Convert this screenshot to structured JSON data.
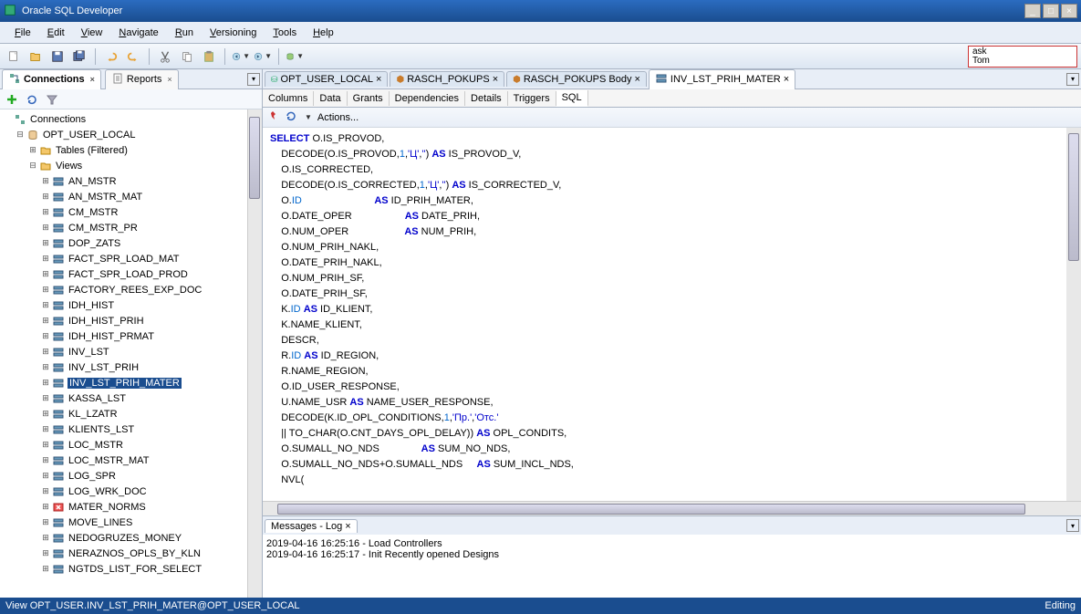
{
  "title": "Oracle SQL Developer",
  "menu": [
    "File",
    "Edit",
    "View",
    "Navigate",
    "Run",
    "Versioning",
    "Tools",
    "Help"
  ],
  "search": {
    "line1": "ask",
    "line2": "Tom"
  },
  "leftTabs": {
    "connections": "Connections",
    "reports": "Reports"
  },
  "tree": {
    "root": "Connections",
    "conn": "OPT_USER_LOCAL",
    "tables": "Tables (Filtered)",
    "views": "Views",
    "items": [
      "AN_MSTR",
      "AN_MSTR_MAT",
      "CM_MSTR",
      "CM_MSTR_PR",
      "DOP_ZATS",
      "FACT_SPR_LOAD_MAT",
      "FACT_SPR_LOAD_PROD",
      "FACTORY_REES_EXP_DOC",
      "IDH_HIST",
      "IDH_HIST_PRIH",
      "IDH_HIST_PRMAT",
      "INV_LST",
      "INV_LST_PRIH",
      "INV_LST_PRIH_MATER",
      "KASSA_LST",
      "KL_LZATR",
      "KLIENTS_LST",
      "LOC_MSTR",
      "LOC_MSTR_MAT",
      "LOG_SPR",
      "LOG_WRK_DOC",
      "MATER_NORMS",
      "MOVE_LINES",
      "NEDOGRUZES_MONEY",
      "NERAZNOS_OPLS_BY_KLN",
      "NGTDS_LIST_FOR_SELECT"
    ],
    "selected": "INV_LST_PRIH_MATER"
  },
  "editorTabs": [
    {
      "label": "OPT_USER_LOCAL",
      "type": "sql"
    },
    {
      "label": "RASCH_POKUPS",
      "type": "cube"
    },
    {
      "label": "RASCH_POKUPS Body",
      "type": "cube"
    },
    {
      "label": "INV_LST_PRIH_MATER",
      "type": "view",
      "active": true
    }
  ],
  "subTabs": [
    "Columns",
    "Data",
    "Grants",
    "Dependencies",
    "Details",
    "Triggers",
    "SQL"
  ],
  "subTabActive": "SQL",
  "actionsLabel": "Actions...",
  "code": [
    {
      "t": "SELECT O.IS_PROVOD,",
      "tokens": [
        {
          "s": "SELECT",
          "c": "kw"
        }
      ]
    },
    {
      "t": "    DECODE(O.IS_PROVOD,1,'Ц','') AS IS_PROVOD_V,",
      "tokens": [
        {
          "s": "1",
          "c": "id"
        },
        {
          "s": "'Ц'",
          "c": "str"
        },
        {
          "s": "''",
          "c": "str"
        },
        {
          "s": "AS",
          "c": "kw"
        }
      ]
    },
    {
      "t": "    O.IS_CORRECTED,"
    },
    {
      "t": "    DECODE(O.IS_CORRECTED,1,'Ц','') AS IS_CORRECTED_V,",
      "tokens": [
        {
          "s": "1",
          "c": "id"
        },
        {
          "s": "'Ц'",
          "c": "str"
        },
        {
          "s": "''",
          "c": "str"
        },
        {
          "s": "AS",
          "c": "kw"
        }
      ]
    },
    {
      "t": "    O.ID                          AS ID_PRIH_MATER,",
      "tokens": [
        {
          "s": "ID",
          "c": "id"
        },
        {
          "s": "AS",
          "c": "kw"
        }
      ]
    },
    {
      "t": "    O.DATE_OPER                   AS DATE_PRIH,",
      "tokens": [
        {
          "s": "AS",
          "c": "kw"
        }
      ]
    },
    {
      "t": "    O.NUM_OPER                    AS NUM_PRIH,",
      "tokens": [
        {
          "s": "AS",
          "c": "kw"
        }
      ]
    },
    {
      "t": "    O.NUM_PRIH_NAKL,"
    },
    {
      "t": "    O.DATE_PRIH_NAKL,"
    },
    {
      "t": "    O.NUM_PRIH_SF,"
    },
    {
      "t": "    O.DATE_PRIH_SF,"
    },
    {
      "t": "    K.ID AS ID_KLIENT,",
      "tokens": [
        {
          "s": "ID",
          "c": "id"
        },
        {
          "s": "AS",
          "c": "kw"
        }
      ]
    },
    {
      "t": "    K.NAME_KLIENT,"
    },
    {
      "t": "    DESCR,"
    },
    {
      "t": "    R.ID AS ID_REGION,",
      "tokens": [
        {
          "s": "ID",
          "c": "id"
        },
        {
          "s": "AS",
          "c": "kw"
        }
      ]
    },
    {
      "t": "    R.NAME_REGION,"
    },
    {
      "t": "    O.ID_USER_RESPONSE,"
    },
    {
      "t": "    U.NAME_USR AS NAME_USER_RESPONSE,",
      "tokens": [
        {
          "s": "AS",
          "c": "kw"
        }
      ]
    },
    {
      "t": "    DECODE(K.ID_OPL_CONDITIONS,1,'Пр.','Отс.'",
      "tokens": [
        {
          "s": "1",
          "c": "id"
        },
        {
          "s": "'Пр.'",
          "c": "str"
        },
        {
          "s": "'Отс.'",
          "c": "str"
        }
      ]
    },
    {
      "t": "    || TO_CHAR(O.CNT_DAYS_OPL_DELAY)) AS OPL_CONDITS,",
      "tokens": [
        {
          "s": "AS",
          "c": "kw"
        }
      ]
    },
    {
      "t": "    O.SUMALL_NO_NDS               AS SUM_NO_NDS,",
      "tokens": [
        {
          "s": "AS",
          "c": "kw"
        }
      ]
    },
    {
      "t": "    O.SUMALL_NO_NDS+O.SUMALL_NDS     AS SUM_INCL_NDS,",
      "tokens": [
        {
          "s": "AS",
          "c": "kw"
        }
      ]
    },
    {
      "t": "    NVL("
    }
  ],
  "log": {
    "title": "Messages - Log",
    "lines": [
      "2019-04-16 16:25:16 - Load Controllers",
      "2019-04-16 16:25:17 - Init Recently opened Designs"
    ]
  },
  "status": {
    "left": "View OPT_USER.INV_LST_PRIH_MATER@OPT_USER_LOCAL",
    "right": "Editing"
  }
}
